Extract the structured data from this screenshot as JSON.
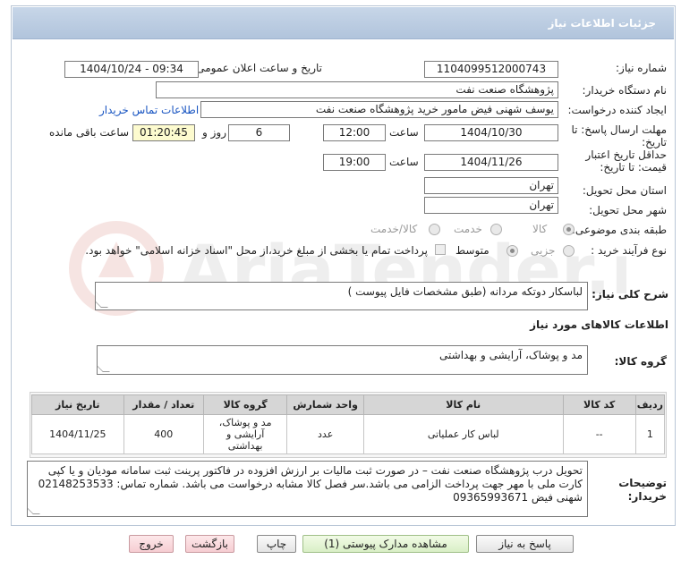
{
  "header": {
    "title": "جزئیات اطلاعات نیاز"
  },
  "fields": {
    "need_number_label": "شماره نیاز:",
    "need_number": "1104099512000743",
    "announce_label": "تاریخ و ساعت اعلان عمومی:",
    "announce_value": "1404/10/24 - 09:34",
    "buyer_org_label": "نام دستگاه خریدار:",
    "buyer_org": "پژوهشگاه صنعت نفت",
    "creator_label": "ایجاد کننده درخواست:",
    "creator": "یوسف شهنی فیض مامور خرید پژوهشگاه صنعت نفت",
    "contact_link": "اطلاعات تماس خریدار",
    "deadline_label_1": "مهلت ارسال پاسخ: تا",
    "deadline_label_2": "تاریخ:",
    "deadline_date": "1404/10/30",
    "hour_label": "ساعت",
    "deadline_time": "12:00",
    "days_value": "6",
    "days_label": "روز و",
    "remaining_time": "01:20:45",
    "remaining_label": "ساعت باقی مانده",
    "validity_label_1": "حداقل تاریخ اعتبار",
    "validity_label_2": "قیمت: تا تاریخ:",
    "validity_date": "1404/11/26",
    "validity_hour_label": "ساعت",
    "validity_time": "19:00",
    "province_label": "استان محل تحویل:",
    "province": "تهران",
    "city_label": "شهر محل تحویل:",
    "city": "تهران",
    "category_label": "طبقه بندی موضوعی:",
    "category_options": [
      "کالا",
      "خدمت",
      "کالا/خدمت"
    ],
    "category_selected": "کالا",
    "process_label": "نوع فرآیند خرید :",
    "process_options": [
      "جزیی",
      "متوسط"
    ],
    "process_selected": "جزیی",
    "payment_note": "پرداخت تمام یا بخشی از مبلغ خرید،از محل \"اسناد خزانه اسلامی\" خواهد بود."
  },
  "description": {
    "label": "شرح کلی نیاز:",
    "text": "لباسکار دوتکه مردانه (طبق مشخصات فایل پیوست )"
  },
  "goods_info": {
    "title": "اطلاعات کالاهای مورد نیاز",
    "group_label": "گروه کالا:",
    "group_value": "مد و پوشاک، آرایشی و بهداشتی"
  },
  "table": {
    "headers": [
      "ردیف",
      "کد کالا",
      "نام کالا",
      "واحد شمارش",
      "گروه کالا",
      "تعداد / مقدار",
      "تاریخ نیاز"
    ],
    "rows": [
      {
        "row": "1",
        "code": "--",
        "name": "لباس کار عملیاتی",
        "unit": "عدد",
        "group": "مد و پوشاک، آرایشی و بهداشتی",
        "qty": "400",
        "date": "1404/11/25"
      }
    ]
  },
  "buyer_notes": {
    "label_1": "توضیحات",
    "label_2": "خریدار:",
    "text": "تحویل درب پژوهشگاه صنعت نفت – در صورت ثبت مالیات بر ارزش افزوده در فاکتور پرینت ثبت سامانه مودیان و یا کپی کارت ملی با مهر جهت پرداخت الزامی می باشد.سر فصل کالا مشابه درخواست می باشد. شماره تماس: 02148253533 شهنی فیض 09365993671"
  },
  "buttons": {
    "reply": "پاسخ به نیاز",
    "view_docs": "مشاهده مدارک پیوستی (1)",
    "print": "چاپ",
    "back": "بازگشت",
    "exit": "خروج"
  },
  "watermark_text": "AriaTender.net",
  "colors": {
    "header": "#b9cbe0",
    "yellow_box": "#fdfbcf",
    "link": "#1a56c2",
    "green_btn": "#d9efc6",
    "pink_btn": "#f6cdd2"
  }
}
